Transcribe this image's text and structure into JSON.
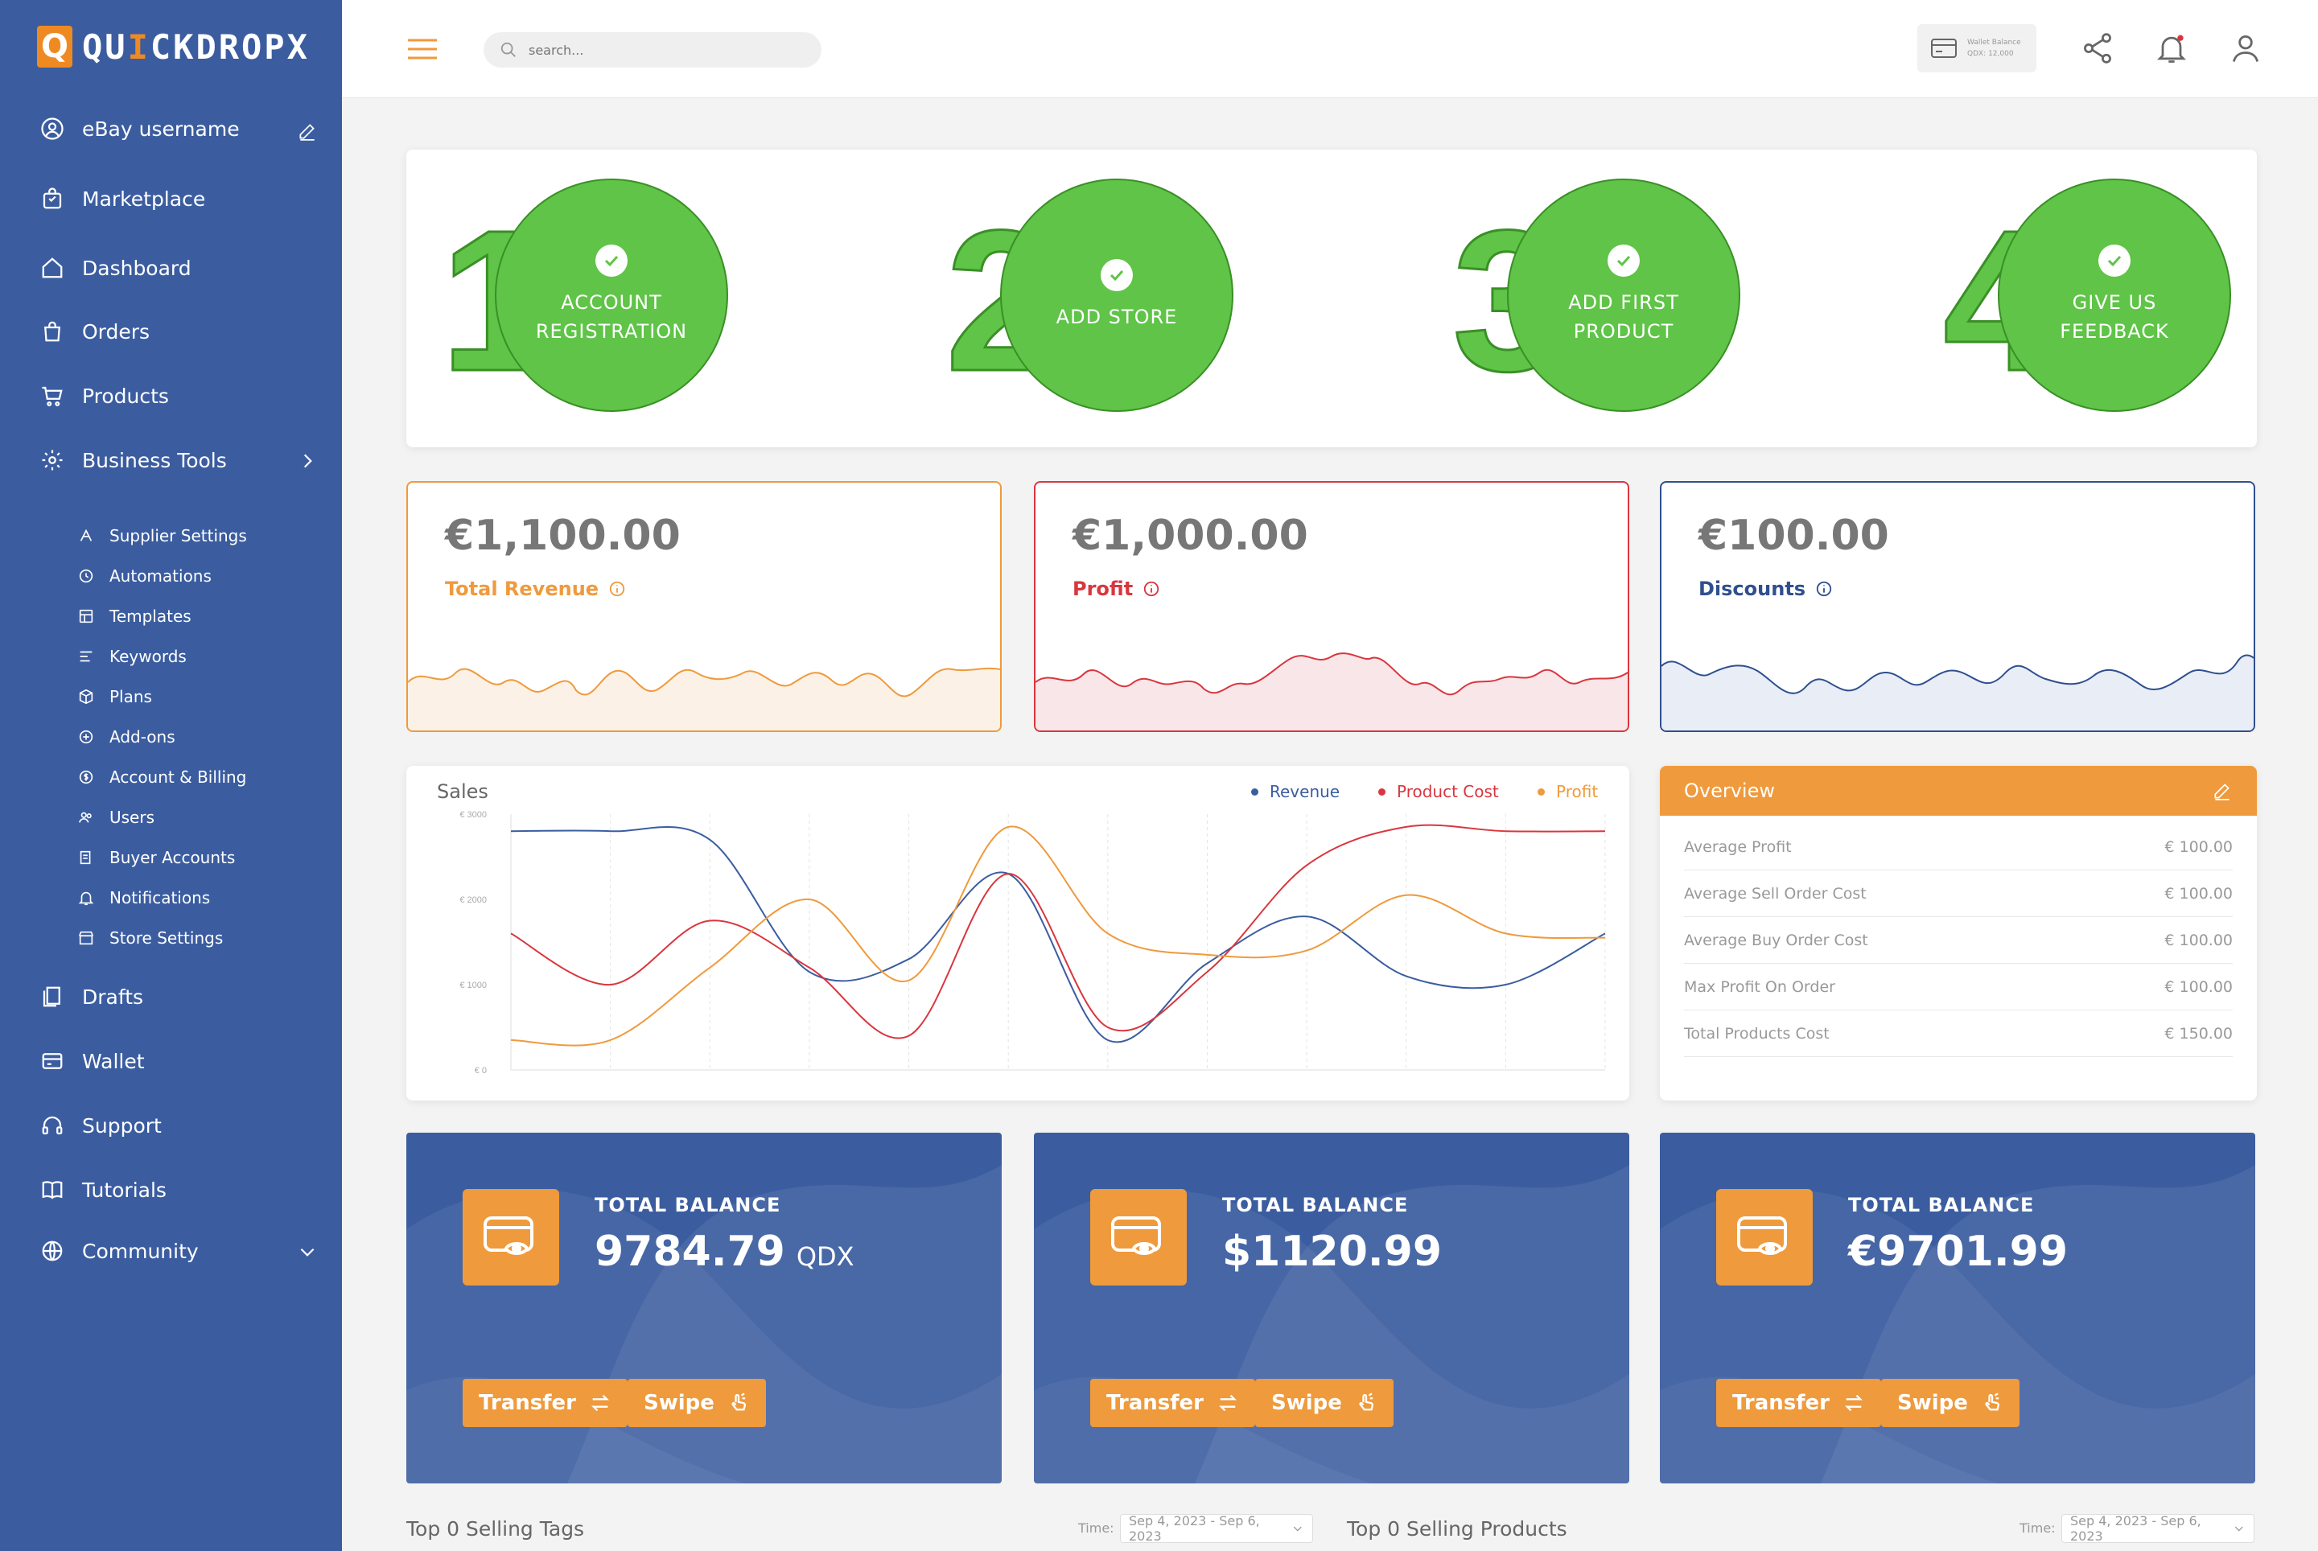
{
  "app": {
    "logo_mark": "Q",
    "logo_text_pre": "QU",
    "logo_text_i": "I",
    "logo_text_post": "CKDROPX"
  },
  "sidebar": {
    "user": "eBay username",
    "items": [
      {
        "label": "Marketplace",
        "icon": "shopping-bag-icon"
      },
      {
        "label": "Dashboard",
        "icon": "home-icon"
      },
      {
        "label": "Orders",
        "icon": "bag-icon"
      },
      {
        "label": "Products",
        "icon": "cart-icon"
      },
      {
        "label": "Business Tools",
        "icon": "gear-icon"
      }
    ],
    "subitems": [
      {
        "label": "Supplier Settings",
        "icon": "supplier-icon"
      },
      {
        "label": "Automations",
        "icon": "automation-icon"
      },
      {
        "label": "Templates",
        "icon": "template-icon"
      },
      {
        "label": "Keywords",
        "icon": "keywords-icon"
      },
      {
        "label": "Plans",
        "icon": "box-icon"
      },
      {
        "label": "Add-ons",
        "icon": "addons-icon"
      },
      {
        "label": "Account & Billing",
        "icon": "billing-icon"
      },
      {
        "label": "Users",
        "icon": "users-icon"
      },
      {
        "label": "Buyer Accounts",
        "icon": "buyer-accounts-icon"
      },
      {
        "label": "Notifications",
        "icon": "bell-icon"
      },
      {
        "label": "Store Settings",
        "icon": "store-icon"
      }
    ],
    "bottom": [
      {
        "label": "Drafts",
        "icon": "drafts-icon"
      },
      {
        "label": "Wallet",
        "icon": "wallet-icon"
      },
      {
        "label": "Support",
        "icon": "headset-icon"
      },
      {
        "label": "Tutorials",
        "icon": "book-icon"
      },
      {
        "label": "Community",
        "icon": "globe-icon"
      }
    ]
  },
  "topbar": {
    "search_placeholder": "search...",
    "wallet_title": "Wallet Balance",
    "wallet_value": "QDX: 12,000"
  },
  "steps": [
    {
      "number": "1",
      "label": "ACCOUNT REGISTRATION",
      "done": true
    },
    {
      "number": "2",
      "label": "ADD STORE",
      "done": true
    },
    {
      "number": "3",
      "label": "ADD FIRST PRODUCT",
      "done": true
    },
    {
      "number": "4",
      "label": "GIVE US FEEDBACK",
      "done": true
    }
  ],
  "kpis": [
    {
      "value": "€1,100.00",
      "label": "Total Revenue",
      "color": "#ef9a3c"
    },
    {
      "value": "€1,000.00",
      "label": "Profit",
      "color": "#d9363e"
    },
    {
      "value": "€100.00",
      "label": "Discounts",
      "color": "#2f4f8f"
    }
  ],
  "sales": {
    "title": "Sales",
    "legend": [
      {
        "name": "Revenue",
        "color": "#3b5da0"
      },
      {
        "name": "Product Cost",
        "color": "#d9363e"
      },
      {
        "name": "Profit",
        "color": "#ef9a3c"
      }
    ]
  },
  "chart_data": {
    "type": "line",
    "title": "Sales",
    "ylim": [
      0,
      3000
    ],
    "yticks": [
      "€ 3000",
      "€ 2000",
      "€ 1000",
      "€ 0"
    ],
    "x": [
      0,
      1,
      2,
      3,
      4,
      5,
      6,
      7,
      8,
      9,
      10,
      11
    ],
    "grid": true,
    "legend_position": "top-right",
    "series": [
      {
        "name": "Revenue",
        "color": "#3b5da0",
        "values": [
          2800,
          2800,
          2700,
          1150,
          1300,
          2300,
          350,
          1250,
          1800,
          1100,
          1000,
          1600
        ]
      },
      {
        "name": "Product Cost",
        "color": "#d9363e",
        "values": [
          1600,
          1000,
          1750,
          1200,
          400,
          2300,
          500,
          1150,
          2400,
          2850,
          2800,
          2800
        ]
      },
      {
        "name": "Profit",
        "color": "#ef9a3c",
        "values": [
          350,
          350,
          1200,
          2000,
          1050,
          2850,
          1600,
          1350,
          1400,
          2050,
          1600,
          1550
        ]
      }
    ]
  },
  "overview": {
    "title": "Overview",
    "rows": [
      {
        "label": "Average Profit",
        "value": "€ 100.00"
      },
      {
        "label": "Average Sell Order Cost",
        "value": "€ 100.00"
      },
      {
        "label": "Average Buy Order Cost",
        "value": "€ 100.00"
      },
      {
        "label": "Max Profit On Order",
        "value": "€ 100.00"
      },
      {
        "label": "Total Products Cost",
        "value": "€ 150.00"
      }
    ]
  },
  "balances": [
    {
      "title": "TOTAL BALANCE",
      "amount": "9784.79",
      "unit": "QDX",
      "transfer": "Transfer",
      "swipe": "Swipe"
    },
    {
      "title": "TOTAL BALANCE",
      "amount": "$1120.99",
      "unit": "",
      "transfer": "Transfer",
      "swipe": "Swipe"
    },
    {
      "title": "TOTAL BALANCE",
      "amount": "€9701.99",
      "unit": "",
      "transfer": "Transfer",
      "swipe": "Swipe"
    }
  ],
  "bottom": {
    "tags_title": "Top 0 Selling Tags",
    "products_title": "Top 0 Selling Products",
    "time_label": "Time:",
    "tags_range": "Sep 4, 2023 - Sep 6, 2023",
    "products_range": "Sep 4, 2023 - Sep 6, 2023"
  }
}
